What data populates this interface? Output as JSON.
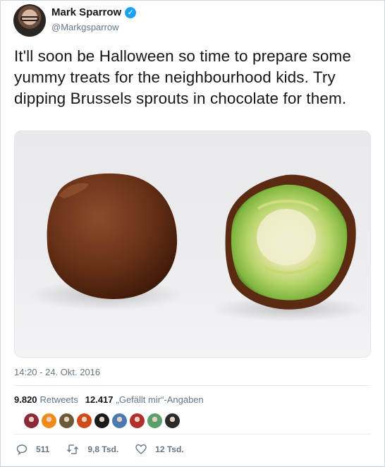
{
  "author": {
    "display_name": "Mark Sparrow",
    "handle": "@Markgsparrow",
    "verified": true
  },
  "tweet": {
    "text": "It'll soon be Halloween so time to prepare some yummy treats for the neighbourhood kids. Try dipping Brussels sprouts in chocolate for them.",
    "timestamp": "14:20 - 24. Okt. 2016"
  },
  "stats": {
    "retweets_count": "9.820",
    "retweets_label": "Retweets",
    "likes_count": "12.417",
    "likes_label": "„Gefällt mir“-Angaben"
  },
  "actions": {
    "reply_count": "511",
    "retweet_count": "9,8 Tsd.",
    "like_count": "12 Tsd."
  },
  "likers": [
    {
      "icon": "liker-avatar",
      "color": "#8a2a3a"
    },
    {
      "icon": "liker-avatar",
      "color": "#f28a1a"
    },
    {
      "icon": "liker-avatar",
      "color": "#6a5a3a"
    },
    {
      "icon": "liker-avatar",
      "color": "#d04a1a"
    },
    {
      "icon": "liker-avatar",
      "color": "#1a1a1a"
    },
    {
      "icon": "liker-avatar",
      "color": "#4a7ab0"
    },
    {
      "icon": "liker-avatar",
      "color": "#b0302a"
    },
    {
      "icon": "liker-avatar",
      "color": "#5aa06a"
    },
    {
      "icon": "liker-avatar",
      "color": "#2a2a2a"
    }
  ],
  "colors": {
    "verified_blue": "#1da1f2",
    "muted_text": "#657786",
    "primary_text": "#14171a"
  }
}
